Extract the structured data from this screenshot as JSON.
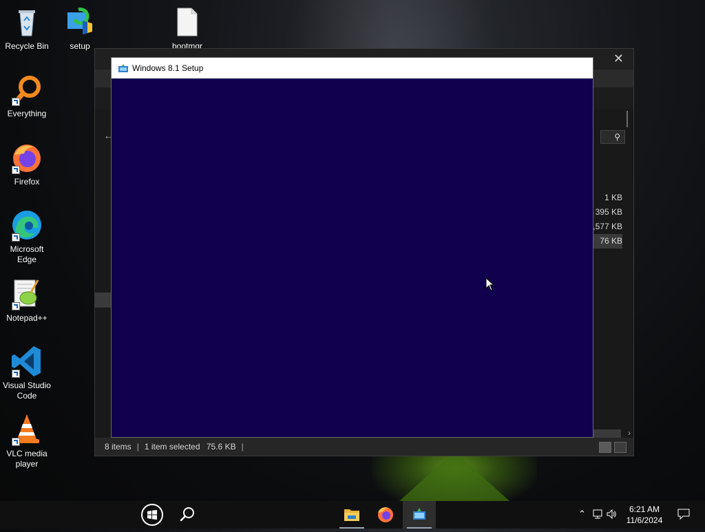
{
  "desktop": {
    "icons": [
      {
        "label": "Recycle Bin",
        "icon": "recycle-bin-icon"
      },
      {
        "label": "setup",
        "icon": "setup-icon"
      },
      {
        "label": "bootmgr",
        "icon": "file-icon"
      },
      {
        "label": "Everything",
        "icon": "everything-icon"
      },
      {
        "label": "Firefox",
        "icon": "firefox-icon"
      },
      {
        "label": "Microsoft Edge",
        "icon": "edge-icon"
      },
      {
        "label": "Notepad++",
        "icon": "notepadpp-icon"
      },
      {
        "label": "Visual Studio Code",
        "icon": "vscode-icon"
      },
      {
        "label": "VLC media player",
        "icon": "vlc-icon"
      }
    ]
  },
  "explorer": {
    "close_glyph": "✕",
    "help_glyph": "?",
    "sizes": [
      "1 KB",
      "395 KB",
      "1,577 KB",
      "76 KB"
    ],
    "status": {
      "items": "8 items",
      "selected": "1 item selected",
      "size": "75.6 KB"
    }
  },
  "setup_window": {
    "title": "Windows 8.1 Setup",
    "content_color": "#11004d"
  },
  "taskbar": {
    "buttons": [
      "start-button",
      "search-button",
      "file-explorer",
      "firefox",
      "windows-setup"
    ],
    "clock": {
      "time": "6:21 AM",
      "date": "11/6/2024"
    }
  }
}
